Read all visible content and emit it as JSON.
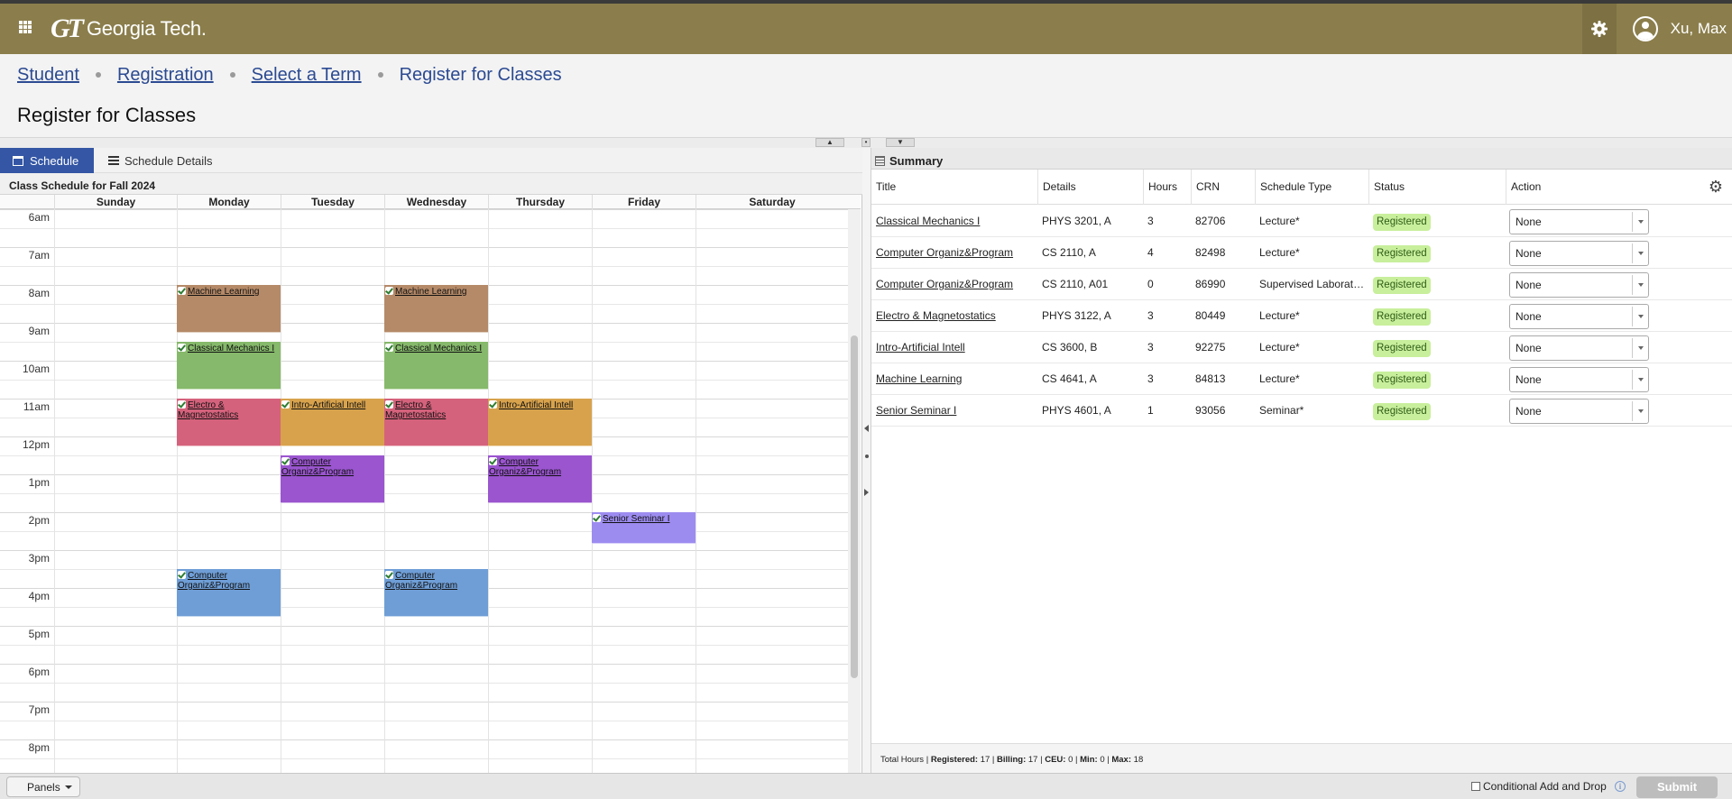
{
  "header": {
    "logo_mark": "GT",
    "logo_text": "Georgia Tech.",
    "user_name": "Xu, Max"
  },
  "breadcrumb": {
    "items": [
      "Student",
      "Registration",
      "Select a Term"
    ],
    "current": "Register for Classes"
  },
  "page_title": "Register for Classes",
  "tabs": {
    "schedule": "Schedule",
    "details": "Schedule Details"
  },
  "schedule": {
    "title": "Class Schedule for Fall 2024",
    "days": [
      "Sunday",
      "Monday",
      "Tuesday",
      "Wednesday",
      "Thursday",
      "Friday",
      "Saturday"
    ],
    "hours": [
      "6am",
      "7am",
      "8am",
      "9am",
      "10am",
      "11am",
      "12pm",
      "1pm",
      "2pm",
      "3pm",
      "4pm",
      "5pm",
      "6pm",
      "7pm",
      "8pm"
    ],
    "events": [
      {
        "title": "Machine Learning",
        "day": 1,
        "start": 8.0,
        "end": 9.25,
        "color": "#b58a68"
      },
      {
        "title": "Machine Learning",
        "day": 3,
        "start": 8.0,
        "end": 9.25,
        "color": "#b58a68"
      },
      {
        "title": "Classical Mechanics I",
        "day": 1,
        "start": 9.5,
        "end": 10.75,
        "color": "#86b96b"
      },
      {
        "title": "Classical Mechanics I",
        "day": 3,
        "start": 9.5,
        "end": 10.75,
        "color": "#86b96b"
      },
      {
        "title": "Electro & Magnetostatics",
        "day": 1,
        "start": 11.0,
        "end": 12.25,
        "color": "#d5627c"
      },
      {
        "title": "Electro & Magnetostatics",
        "day": 3,
        "start": 11.0,
        "end": 12.25,
        "color": "#d5627c"
      },
      {
        "title": "Intro-Artificial Intell",
        "day": 2,
        "start": 11.0,
        "end": 12.25,
        "color": "#d8a24c"
      },
      {
        "title": "Intro-Artificial Intell",
        "day": 4,
        "start": 11.0,
        "end": 12.25,
        "color": "#d8a24c"
      },
      {
        "title": "Computer Organiz&Program",
        "day": 2,
        "start": 12.5,
        "end": 13.75,
        "color": "#9a55cf"
      },
      {
        "title": "Computer Organiz&Program",
        "day": 4,
        "start": 12.5,
        "end": 13.75,
        "color": "#9a55cf"
      },
      {
        "title": "Senior Seminar I",
        "day": 5,
        "start": 14.0,
        "end": 14.83,
        "color": "#9d8cf0"
      },
      {
        "title": "Computer Organiz&Program",
        "day": 1,
        "start": 15.5,
        "end": 16.75,
        "color": "#6f9ed6"
      },
      {
        "title": "Computer Organiz&Program",
        "day": 3,
        "start": 15.5,
        "end": 16.75,
        "color": "#6f9ed6"
      }
    ]
  },
  "summary": {
    "title": "Summary",
    "columns": [
      "Title",
      "Details",
      "Hours",
      "CRN",
      "Schedule Type",
      "Status",
      "Action"
    ],
    "rows": [
      {
        "title": "Classical Mechanics I",
        "details": "PHYS 3201, A",
        "hours": "3",
        "crn": "82706",
        "type": "Lecture*",
        "status": "Registered",
        "action": "None"
      },
      {
        "title": "Computer Organiz&Program",
        "details": "CS 2110, A",
        "hours": "4",
        "crn": "82498",
        "type": "Lecture*",
        "status": "Registered",
        "action": "None"
      },
      {
        "title": "Computer Organiz&Program",
        "details": "CS 2110, A01",
        "hours": "0",
        "crn": "86990",
        "type": "Supervised Laboratory*",
        "status": "Registered",
        "action": "None"
      },
      {
        "title": "Electro & Magnetostatics",
        "details": "PHYS 3122, A",
        "hours": "3",
        "crn": "80449",
        "type": "Lecture*",
        "status": "Registered",
        "action": "None"
      },
      {
        "title": "Intro-Artificial Intell",
        "details": "CS 3600, B",
        "hours": "3",
        "crn": "92275",
        "type": "Lecture*",
        "status": "Registered",
        "action": "None"
      },
      {
        "title": "Machine Learning",
        "details": "CS 4641, A",
        "hours": "3",
        "crn": "84813",
        "type": "Lecture*",
        "status": "Registered",
        "action": "None"
      },
      {
        "title": "Senior Seminar I",
        "details": "PHYS 4601, A",
        "hours": "1",
        "crn": "93056",
        "type": "Seminar*",
        "status": "Registered",
        "action": "None"
      }
    ],
    "totals": {
      "label": "Total Hours",
      "registered_label": "Registered:",
      "registered": "17",
      "billing_label": "Billing:",
      "billing": "17",
      "ceu_label": "CEU:",
      "ceu": "0",
      "min_label": "Min:",
      "min": "0",
      "max_label": "Max:",
      "max": "18"
    }
  },
  "bottom": {
    "panels_label": "Panels",
    "conditional_label": "Conditional Add and Drop",
    "submit_label": "Submit"
  },
  "colors": {
    "header": "#8b7e4c",
    "tab_active": "#3456a4",
    "link": "#2b4a92",
    "badge": "#c8ef9c"
  }
}
